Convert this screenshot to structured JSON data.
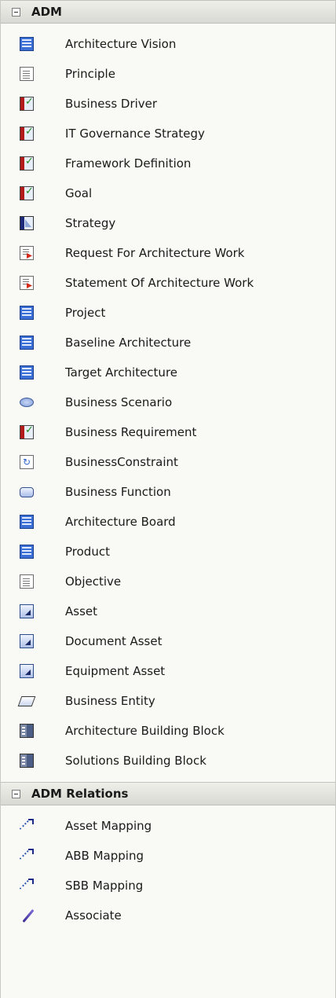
{
  "groups": [
    {
      "title": "ADM",
      "items": [
        {
          "label": "Architecture Vision",
          "icon": "document-blue-icon"
        },
        {
          "label": "Principle",
          "icon": "page-icon"
        },
        {
          "label": "Business Driver",
          "icon": "requirement-icon"
        },
        {
          "label": "IT Governance Strategy",
          "icon": "requirement-icon"
        },
        {
          "label": "Framework Definition",
          "icon": "requirement-icon"
        },
        {
          "label": "Goal",
          "icon": "requirement-icon"
        },
        {
          "label": "Strategy",
          "icon": "strategy-icon"
        },
        {
          "label": "Request For Architecture Work",
          "icon": "page-red-arrow-icon"
        },
        {
          "label": "Statement Of Architecture Work",
          "icon": "page-red-arrow-icon"
        },
        {
          "label": "Project",
          "icon": "document-blue-icon"
        },
        {
          "label": "Baseline Architecture",
          "icon": "document-blue-icon"
        },
        {
          "label": "Target Architecture",
          "icon": "document-blue-icon"
        },
        {
          "label": "Business Scenario",
          "icon": "ellipse-icon"
        },
        {
          "label": "Business Requirement",
          "icon": "requirement-icon"
        },
        {
          "label": "BusinessConstraint",
          "icon": "page-rotate-icon"
        },
        {
          "label": "Business Function",
          "icon": "rounded-rect-icon"
        },
        {
          "label": "Architecture Board",
          "icon": "document-blue-icon"
        },
        {
          "label": "Product",
          "icon": "document-blue-icon"
        },
        {
          "label": "Objective",
          "icon": "page-icon"
        },
        {
          "label": "Asset",
          "icon": "asset-icon"
        },
        {
          "label": "Document Asset",
          "icon": "asset-icon"
        },
        {
          "label": "Equipment Asset",
          "icon": "asset-icon"
        },
        {
          "label": "Business Entity",
          "icon": "parallelogram-icon"
        },
        {
          "label": "Architecture Building Block",
          "icon": "building-block-icon"
        },
        {
          "label": "Solutions Building Block",
          "icon": "building-block-icon"
        }
      ]
    },
    {
      "title": "ADM Relations",
      "items": [
        {
          "label": "Asset Mapping",
          "icon": "mapping-arrow-icon"
        },
        {
          "label": "ABB Mapping",
          "icon": "mapping-arrow-icon"
        },
        {
          "label": "SBB Mapping",
          "icon": "mapping-arrow-icon"
        },
        {
          "label": "Associate",
          "icon": "associate-line-icon"
        }
      ]
    }
  ]
}
